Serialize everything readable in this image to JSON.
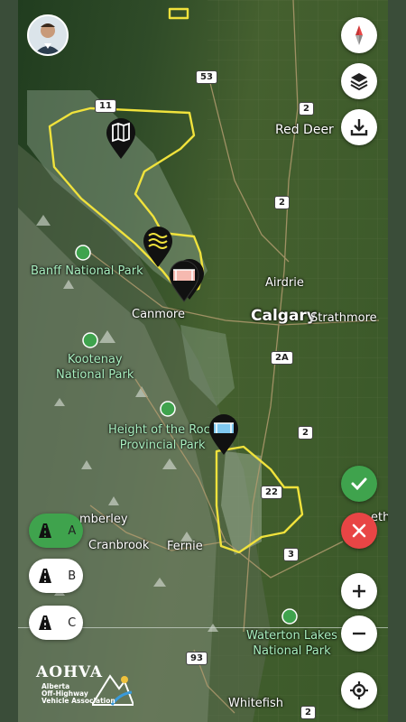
{
  "map": {
    "cities": [
      "Red Deer",
      "Airdrie",
      "Calgary",
      "Strathmore",
      "Canmore",
      "Cranbrook",
      "Fernie",
      "Whitefish",
      "Kimberley"
    ],
    "parks": [
      "Banff National Park",
      "Kootenay National Park",
      "Height of the Rock Provincial Park",
      "Waterton Lakes National Park"
    ],
    "shields": [
      "53",
      "2",
      "2",
      "2",
      "2A",
      "2",
      "22",
      "3",
      "93",
      "2",
      "11"
    ]
  },
  "labels": {
    "red_deer": "Red Deer",
    "airdrie": "Airdrie",
    "calgary": "Calgary",
    "strathmore": "Strathmore",
    "canmore": "Canmore",
    "cranbrook": "Cranbrook",
    "fernie": "Fernie",
    "whitefish": "Whitefish",
    "kimberley": "mberley",
    "partial_right": "eth",
    "banff": "Banff National Park",
    "kootenay_1": "Kootenay",
    "kootenay_2": "National Park",
    "height_1": "Height of the Rock",
    "height_2": "Provincial Park",
    "waterton_1": "Waterton Lakes",
    "waterton_2": "National Park"
  },
  "shields": {
    "s53": "53",
    "s2a": "2",
    "s2b": "2",
    "s2c": "2A",
    "s2d": "2",
    "s22": "22",
    "s3": "3",
    "s93": "93",
    "s2e": "2",
    "s11": "11"
  },
  "filters": {
    "a": "A",
    "b": "B",
    "c": "C",
    "active": "A"
  },
  "logo": {
    "name": "AOHVA",
    "line1": "Alberta",
    "line2": "Off-Highway",
    "line3": "Vehicle Association"
  },
  "colors": {
    "accent_green": "#3fa34d",
    "cancel_red": "#e84545",
    "trail_yellow": "#f0e23c"
  }
}
